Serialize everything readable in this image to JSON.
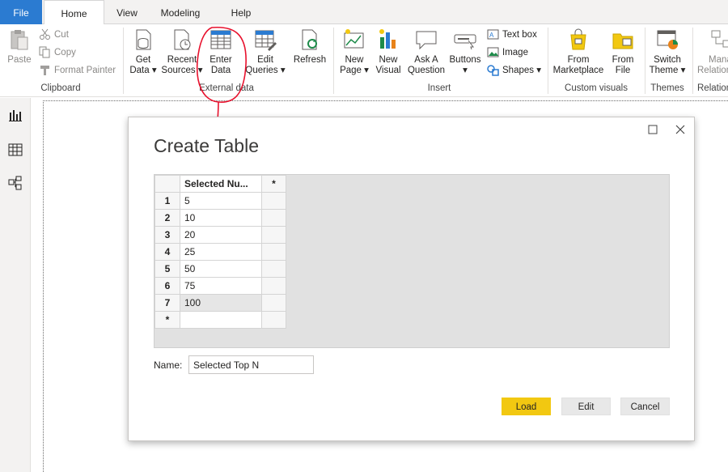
{
  "tabs": {
    "file": "File",
    "home": "Home",
    "view": "View",
    "modeling": "Modeling",
    "help": "Help"
  },
  "ribbon": {
    "clipboard": {
      "paste": "Paste",
      "cut": "Cut",
      "copy": "Copy",
      "format_painter": "Format Painter",
      "label": "Clipboard"
    },
    "external": {
      "get_data_1": "Get",
      "get_data_2": "Data ▾",
      "recent_1": "Recent",
      "recent_2": "Sources ▾",
      "enter_1": "Enter",
      "enter_2": "Data",
      "edit_1": "Edit",
      "edit_2": "Queries ▾",
      "refresh": "Refresh",
      "label": "External data"
    },
    "insert": {
      "new_page_1": "New",
      "new_page_2": "Page ▾",
      "new_visual_1": "New",
      "new_visual_2": "Visual",
      "ask_1": "Ask A",
      "ask_2": "Question",
      "buttons_1": "Buttons",
      "buttons_2": "▾",
      "text_box": "Text box",
      "image": "Image",
      "shapes": "Shapes ▾",
      "label": "Insert"
    },
    "custom": {
      "market_1": "From",
      "market_2": "Marketplace",
      "file_1": "From",
      "file_2": "File",
      "label": "Custom visuals"
    },
    "themes": {
      "switch_1": "Switch",
      "switch_2": "Theme ▾",
      "label": "Themes"
    },
    "relationships": {
      "manage_1": "Mana",
      "manage_2": "Relation",
      "label": "Relation"
    }
  },
  "dialog": {
    "title": "Create Table",
    "column_header": "Selected Nu...",
    "add_column": "*",
    "rows": [
      {
        "num": "1",
        "value": "5"
      },
      {
        "num": "2",
        "value": "10"
      },
      {
        "num": "3",
        "value": "20"
      },
      {
        "num": "4",
        "value": "25"
      },
      {
        "num": "5",
        "value": "50"
      },
      {
        "num": "6",
        "value": "75"
      },
      {
        "num": "7",
        "value": "100"
      }
    ],
    "new_row": "*",
    "name_label": "Name:",
    "name_value": "Selected Top N",
    "load": "Load",
    "edit": "Edit",
    "cancel": "Cancel"
  },
  "colors": {
    "file_tab": "#2b7bd1",
    "load_button": "#f2c811",
    "annotation": "#e8112d"
  }
}
